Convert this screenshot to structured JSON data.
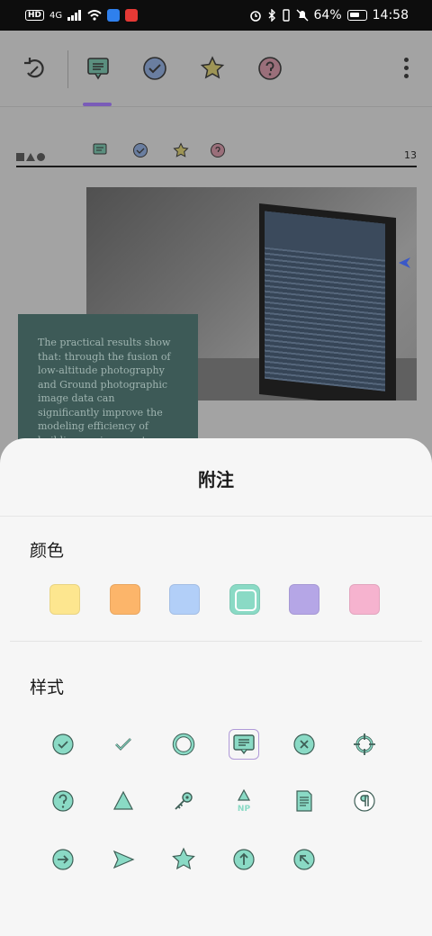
{
  "status_bar": {
    "network": "HD",
    "signal_label": "4G",
    "battery": "64%",
    "time": "14:58"
  },
  "toolbar": {
    "icons": [
      "undo-icon",
      "note-icon",
      "check-icon",
      "star-icon",
      "question-icon",
      "more-icon"
    ]
  },
  "document": {
    "page_number": "13",
    "note_text": "The practical results show that: through the fusion of low-altitude photography and Ground photographic image data can significantly improve the modeling efficiency of building environment information and the modeling"
  },
  "sheet": {
    "title": "附注",
    "color_label": "颜色",
    "style_label": "样式",
    "colors": [
      "#fde68f",
      "#fcb56a",
      "#b2cff8",
      "#8adac5",
      "#b5a6e6",
      "#f6b3cf"
    ],
    "selected_color_index": 3,
    "accent": "#8adac5",
    "stroke": "#3e5f56",
    "styles": [
      [
        "check-circle-icon",
        "checkmark-icon",
        "circle-icon",
        "comment-icon",
        "cross-circle-icon",
        "crosshair-icon"
      ],
      [
        "help-icon",
        "triangle-icon",
        "key-icon",
        "new-paragraph-icon",
        "document-icon",
        "paragraph-icon"
      ],
      [
        "arrow-right-circle-icon",
        "send-icon",
        "star-icon",
        "arrow-up-circle-icon",
        "arrow-upleft-circle-icon"
      ]
    ],
    "np_label": "NP",
    "selected_style": "comment-icon"
  }
}
